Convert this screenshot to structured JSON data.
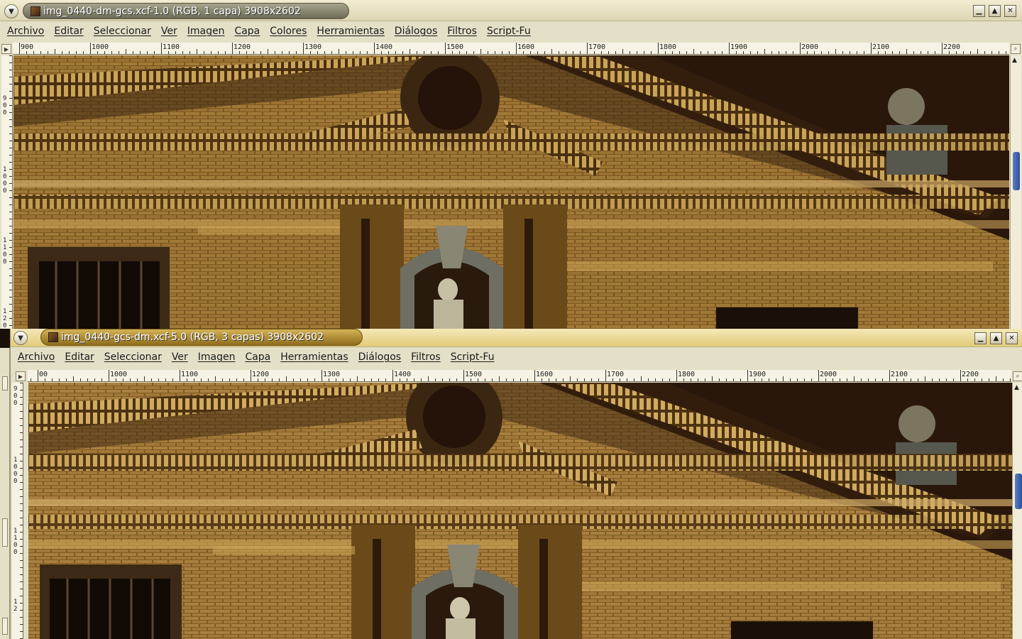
{
  "window1": {
    "title": "img_0440-dm-gcs.xcf-1.0 (RGB, 1 capa) 3908x2602",
    "menu": [
      "Archivo",
      "Editar",
      "Seleccionar",
      "Ver",
      "Imagen",
      "Capa",
      "Colores",
      "Herramientas",
      "Diálogos",
      "Filtros",
      "Script-Fu"
    ],
    "ruler_labels": [
      "900",
      "1000",
      "1100",
      "1200",
      "1300",
      "1400",
      "1500",
      "1600",
      "1700",
      "1800",
      "1900",
      "2000",
      "2100",
      "2200"
    ],
    "vruler_labels": [
      "900",
      "1000",
      "1100",
      "1200"
    ]
  },
  "window2": {
    "title": "img_0440-gcs-dm.xcf-5.0 (RGB, 3 capas) 3908x2602",
    "menu": [
      "Archivo",
      "Editar",
      "Seleccionar",
      "Ver",
      "Imagen",
      "Capa",
      "Herramientas",
      "Diálogos",
      "Filtros",
      "Script-Fu"
    ],
    "ruler_labels": [
      "00",
      "1000",
      "1100",
      "1200",
      "1300",
      "1400",
      "1500",
      "1600",
      "1700",
      "1800",
      "1900",
      "2000",
      "2100",
      "2200"
    ],
    "vruler_labels": [
      "900",
      "1000",
      "1100",
      "12"
    ]
  },
  "icons": {
    "menu": "chevron-down-icon",
    "minimize": "minimize-icon",
    "maximize": "maximize-icon",
    "close": "close-icon",
    "nav": "navigate-icon",
    "zoom": "zoom-icon"
  },
  "colors": {
    "brick": "#6b4a1c",
    "brick_light": "#a07a3c",
    "sky": "#2a170b",
    "scroll_thumb": "#2c4f99"
  }
}
